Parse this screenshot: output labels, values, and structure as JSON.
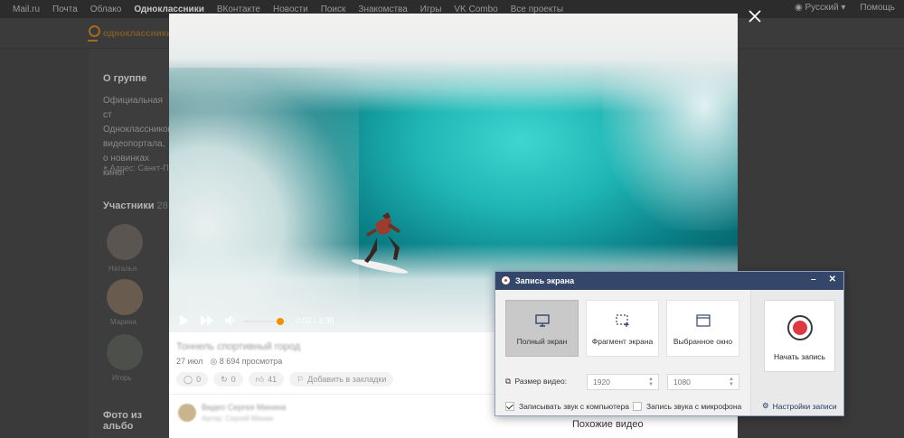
{
  "topbar": {
    "links": [
      "Mail.ru",
      "Почта",
      "Облако",
      "Одноклассники",
      "ВКонтакте",
      "Новости",
      "Поиск",
      "Знакомства",
      "Игры",
      "VK Combo",
      "Все проекты"
    ],
    "language": "Русский",
    "help": "Помощь"
  },
  "ok": {
    "logo_text": "одноклассники",
    "about_title": "О группе",
    "about_text": "Официальная ст Одноклассников видеопортала, о новинках кино!",
    "address": "Адрес: Санкт-П",
    "members_title": "Участники",
    "members_count": "28",
    "member_names": [
      "Наталья",
      "Марина",
      "Игорь"
    ],
    "photos_title": "Фото из альбо"
  },
  "video": {
    "time": "0:02 / 2:38",
    "title": "Тоннель спортивный город",
    "date": "27 июл",
    "views": "8 694 просмотра",
    "comments": "0",
    "shares": "0",
    "likes": "41",
    "bookmark": "Добавить в закладки",
    "comment_author": "Видео Сергея Минина",
    "comment_sub": "Автор: Сергей Минин",
    "similar": "Похожие видео",
    "volume_level": 0.75
  },
  "recorder": {
    "title": "Запись экрана",
    "modes": [
      {
        "label": "Полный экран",
        "icon": "monitor-icon",
        "active": true
      },
      {
        "label": "Фрагмент экрана",
        "icon": "fragment-select-icon",
        "active": false
      },
      {
        "label": "Выбранное окно",
        "icon": "window-icon",
        "active": false
      }
    ],
    "video_size_label": "Размер видео:",
    "width": "1920",
    "height": "1080",
    "record_system_audio": "Записывать звук с компьютера",
    "record_system_audio_checked": true,
    "record_mic": "Запись звука с микрофона",
    "record_mic_checked": false,
    "start_label": "Начать запись",
    "settings_label": "Настройки записи"
  },
  "colors": {
    "accent_orange": "#f29200",
    "recorder_title_bg": "#34466a",
    "record_red": "#dc3a40"
  }
}
